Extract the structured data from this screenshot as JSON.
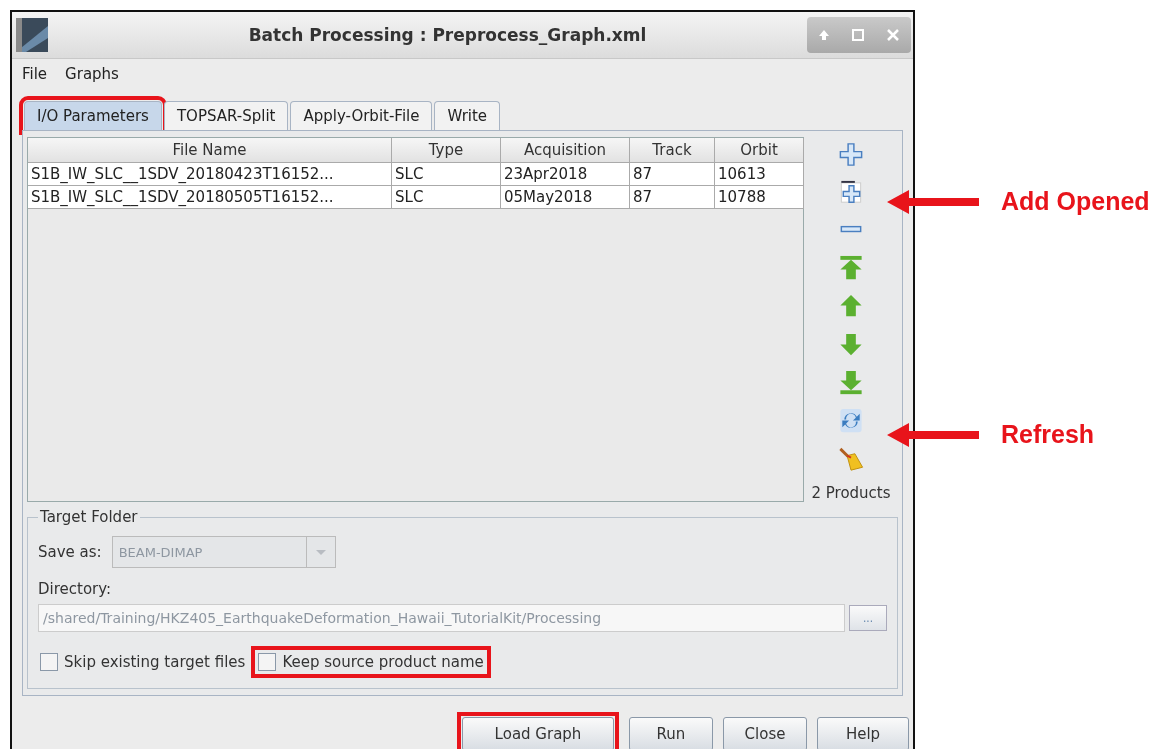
{
  "window": {
    "title": "Batch Processing : Preprocess_Graph.xml"
  },
  "menu": [
    "File",
    "Graphs"
  ],
  "tabs": [
    {
      "label": "I/O Parameters",
      "selected": true,
      "highlighted": true
    },
    {
      "label": "TOPSAR-Split",
      "selected": false,
      "highlighted": false
    },
    {
      "label": "Apply-Orbit-File",
      "selected": false,
      "highlighted": false
    },
    {
      "label": "Write",
      "selected": false,
      "highlighted": false
    }
  ],
  "table": {
    "columns": [
      "File Name",
      "Type",
      "Acquisition",
      "Track",
      "Orbit"
    ],
    "rows": [
      [
        "S1B_IW_SLC__1SDV_20180423T16152...",
        "SLC",
        "23Apr2018",
        "87",
        "10613"
      ],
      [
        "S1B_IW_SLC__1SDV_20180505T16152...",
        "SLC",
        "05May2018",
        "87",
        "10788"
      ]
    ]
  },
  "product_count": "2 Products",
  "target_folder": {
    "title": "Target Folder",
    "save_as_label": "Save as:",
    "save_as_value": "BEAM-DIMAP",
    "directory_label": "Directory:",
    "directory_value": "/shared/Training/HKZ405_EarthquakeDeformation_Hawaii_TutorialKit/Processing",
    "browse": "...",
    "checkboxes": [
      {
        "label": "Skip existing target files",
        "checked": false,
        "highlighted": false
      },
      {
        "label": "Keep source product name",
        "checked": false,
        "highlighted": true
      }
    ]
  },
  "buttons": [
    {
      "label": "Load Graph",
      "highlighted": true
    },
    {
      "label": "Run",
      "highlighted": false
    },
    {
      "label": "Close",
      "highlighted": false
    },
    {
      "label": "Help",
      "highlighted": false
    }
  ],
  "callouts": [
    {
      "text": "Add Opened"
    },
    {
      "text": "Refresh"
    }
  ]
}
